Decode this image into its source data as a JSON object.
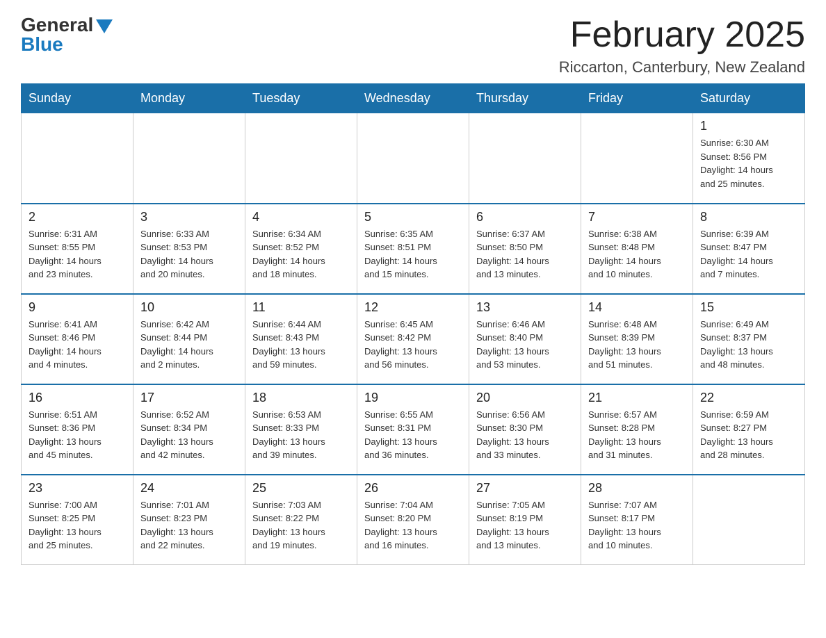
{
  "header": {
    "logo_general": "General",
    "logo_blue": "Blue",
    "month_title": "February 2025",
    "location": "Riccarton, Canterbury, New Zealand"
  },
  "days_of_week": [
    "Sunday",
    "Monday",
    "Tuesday",
    "Wednesday",
    "Thursday",
    "Friday",
    "Saturday"
  ],
  "weeks": [
    {
      "days": [
        {
          "num": "",
          "info": ""
        },
        {
          "num": "",
          "info": ""
        },
        {
          "num": "",
          "info": ""
        },
        {
          "num": "",
          "info": ""
        },
        {
          "num": "",
          "info": ""
        },
        {
          "num": "",
          "info": ""
        },
        {
          "num": "1",
          "info": "Sunrise: 6:30 AM\nSunset: 8:56 PM\nDaylight: 14 hours\nand 25 minutes."
        }
      ]
    },
    {
      "days": [
        {
          "num": "2",
          "info": "Sunrise: 6:31 AM\nSunset: 8:55 PM\nDaylight: 14 hours\nand 23 minutes."
        },
        {
          "num": "3",
          "info": "Sunrise: 6:33 AM\nSunset: 8:53 PM\nDaylight: 14 hours\nand 20 minutes."
        },
        {
          "num": "4",
          "info": "Sunrise: 6:34 AM\nSunset: 8:52 PM\nDaylight: 14 hours\nand 18 minutes."
        },
        {
          "num": "5",
          "info": "Sunrise: 6:35 AM\nSunset: 8:51 PM\nDaylight: 14 hours\nand 15 minutes."
        },
        {
          "num": "6",
          "info": "Sunrise: 6:37 AM\nSunset: 8:50 PM\nDaylight: 14 hours\nand 13 minutes."
        },
        {
          "num": "7",
          "info": "Sunrise: 6:38 AM\nSunset: 8:48 PM\nDaylight: 14 hours\nand 10 minutes."
        },
        {
          "num": "8",
          "info": "Sunrise: 6:39 AM\nSunset: 8:47 PM\nDaylight: 14 hours\nand 7 minutes."
        }
      ]
    },
    {
      "days": [
        {
          "num": "9",
          "info": "Sunrise: 6:41 AM\nSunset: 8:46 PM\nDaylight: 14 hours\nand 4 minutes."
        },
        {
          "num": "10",
          "info": "Sunrise: 6:42 AM\nSunset: 8:44 PM\nDaylight: 14 hours\nand 2 minutes."
        },
        {
          "num": "11",
          "info": "Sunrise: 6:44 AM\nSunset: 8:43 PM\nDaylight: 13 hours\nand 59 minutes."
        },
        {
          "num": "12",
          "info": "Sunrise: 6:45 AM\nSunset: 8:42 PM\nDaylight: 13 hours\nand 56 minutes."
        },
        {
          "num": "13",
          "info": "Sunrise: 6:46 AM\nSunset: 8:40 PM\nDaylight: 13 hours\nand 53 minutes."
        },
        {
          "num": "14",
          "info": "Sunrise: 6:48 AM\nSunset: 8:39 PM\nDaylight: 13 hours\nand 51 minutes."
        },
        {
          "num": "15",
          "info": "Sunrise: 6:49 AM\nSunset: 8:37 PM\nDaylight: 13 hours\nand 48 minutes."
        }
      ]
    },
    {
      "days": [
        {
          "num": "16",
          "info": "Sunrise: 6:51 AM\nSunset: 8:36 PM\nDaylight: 13 hours\nand 45 minutes."
        },
        {
          "num": "17",
          "info": "Sunrise: 6:52 AM\nSunset: 8:34 PM\nDaylight: 13 hours\nand 42 minutes."
        },
        {
          "num": "18",
          "info": "Sunrise: 6:53 AM\nSunset: 8:33 PM\nDaylight: 13 hours\nand 39 minutes."
        },
        {
          "num": "19",
          "info": "Sunrise: 6:55 AM\nSunset: 8:31 PM\nDaylight: 13 hours\nand 36 minutes."
        },
        {
          "num": "20",
          "info": "Sunrise: 6:56 AM\nSunset: 8:30 PM\nDaylight: 13 hours\nand 33 minutes."
        },
        {
          "num": "21",
          "info": "Sunrise: 6:57 AM\nSunset: 8:28 PM\nDaylight: 13 hours\nand 31 minutes."
        },
        {
          "num": "22",
          "info": "Sunrise: 6:59 AM\nSunset: 8:27 PM\nDaylight: 13 hours\nand 28 minutes."
        }
      ]
    },
    {
      "days": [
        {
          "num": "23",
          "info": "Sunrise: 7:00 AM\nSunset: 8:25 PM\nDaylight: 13 hours\nand 25 minutes."
        },
        {
          "num": "24",
          "info": "Sunrise: 7:01 AM\nSunset: 8:23 PM\nDaylight: 13 hours\nand 22 minutes."
        },
        {
          "num": "25",
          "info": "Sunrise: 7:03 AM\nSunset: 8:22 PM\nDaylight: 13 hours\nand 19 minutes."
        },
        {
          "num": "26",
          "info": "Sunrise: 7:04 AM\nSunset: 8:20 PM\nDaylight: 13 hours\nand 16 minutes."
        },
        {
          "num": "27",
          "info": "Sunrise: 7:05 AM\nSunset: 8:19 PM\nDaylight: 13 hours\nand 13 minutes."
        },
        {
          "num": "28",
          "info": "Sunrise: 7:07 AM\nSunset: 8:17 PM\nDaylight: 13 hours\nand 10 minutes."
        },
        {
          "num": "",
          "info": ""
        }
      ]
    }
  ]
}
